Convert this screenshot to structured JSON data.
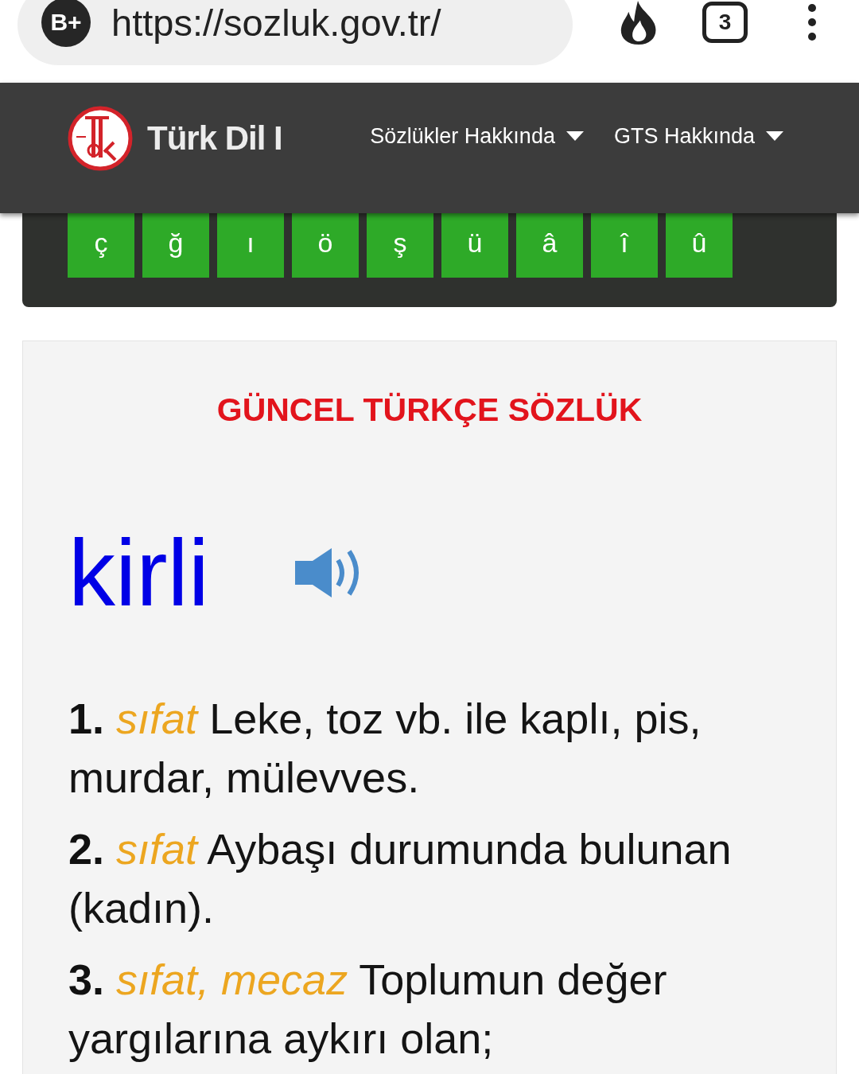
{
  "browser": {
    "badge": "B+",
    "url": "https://sozluk.gov.tr/",
    "tab_count": "3"
  },
  "header": {
    "logo_text": "Türk Dil I",
    "nav": [
      {
        "label": "Sözlükler Hakkında"
      },
      {
        "label": "GTS Hakkında"
      }
    ]
  },
  "keyboard": {
    "keys": [
      "ç",
      "ğ",
      "ı",
      "ö",
      "ş",
      "ü",
      "â",
      "î",
      "û"
    ]
  },
  "result": {
    "title": "GÜNCEL TÜRKÇE SÖZLÜK",
    "word": "kirli",
    "definitions": [
      {
        "number": "1.",
        "tags": "sıfat",
        "text": "Leke, toz vb. ile kaplı, pis, murdar, mülevves."
      },
      {
        "number": "2.",
        "tags": "sıfat",
        "text": "Aybaşı durumunda bulunan (kadın)."
      },
      {
        "number": "3.",
        "tags": "sıfat, mecaz",
        "text": "Toplumun değer yargılarına aykırı olan;"
      }
    ]
  }
}
